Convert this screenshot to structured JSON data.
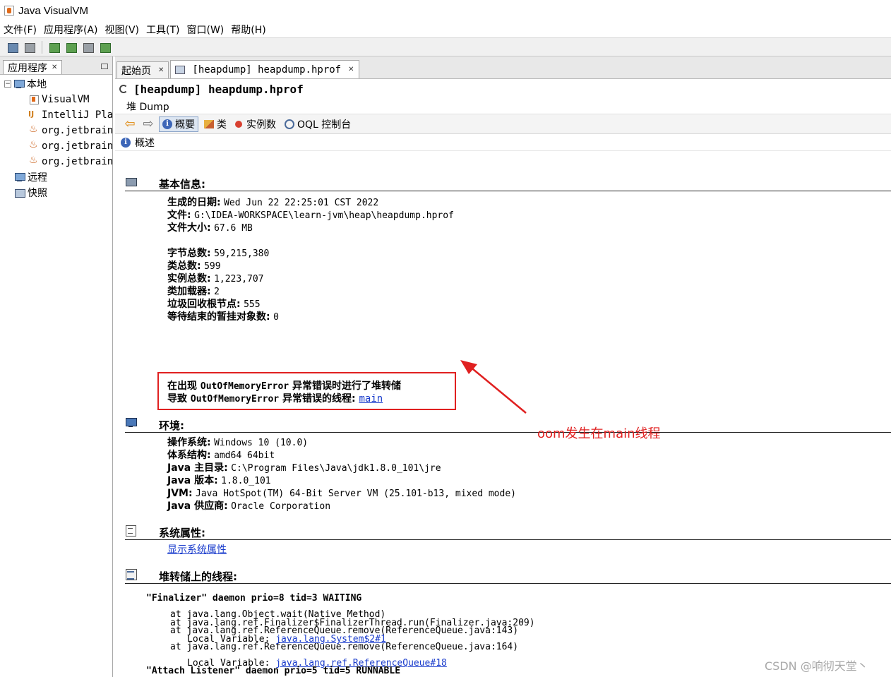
{
  "window": {
    "title": "Java VisualVM"
  },
  "menu": [
    "文件(F)",
    "应用程序(A)",
    "视图(V)",
    "工具(T)",
    "窗口(W)",
    "帮助(H)"
  ],
  "left_panel": {
    "tab_label": "应用程序",
    "tree": {
      "local": "本地",
      "items": [
        "VisualVM",
        "IntelliJ Pla",
        "org.jetbrain",
        "org.jetbrain",
        "org.jetbrain"
      ],
      "remote": "远程",
      "snapshots": "快照"
    }
  },
  "doc_tabs": [
    {
      "label": "起始页"
    },
    {
      "label": "[heapdump] heapdump.hprof"
    }
  ],
  "doc": {
    "title": "[heapdump] heapdump.hprof",
    "subtab": "堆 Dump",
    "views": {
      "summary": "概要",
      "classes": "类",
      "instances": "实例数",
      "oql": "OQL 控制台"
    },
    "overview_label": "概述"
  },
  "basic_info": {
    "title": "基本信息:",
    "generated_label": "生成的日期:",
    "generated_value": "Wed Jun 22 22:25:01 CST 2022",
    "file_label": "文件:",
    "file_value": "G:\\IDEA-WORKSPACE\\learn-jvm\\heap\\heapdump.hprof",
    "size_label": "文件大小:",
    "size_value": "67.6 MB",
    "bytes_label": "字节总数:",
    "bytes_value": "59,215,380",
    "classes_label": "类总数:",
    "classes_value": "599",
    "instances_label": "实例总数:",
    "instances_value": "1,223,707",
    "loaders_label": "类加载器:",
    "loaders_value": "2",
    "gc_roots_label": "垃圾回收根节点:",
    "gc_roots_value": "555",
    "finalizer_label": "等待结束的暂挂对象数:",
    "finalizer_value": "0",
    "oom_line1_pre": "在出现",
    "oom_line1_err": "OutOfMemoryError",
    "oom_line1_post": "异常错误时进行了堆转储",
    "oom_line2_pre": "导致",
    "oom_line2_err": "OutOfMemoryError",
    "oom_line2_post": "异常错误的线程:",
    "oom_thread_link": "main"
  },
  "environment": {
    "title": "环境:",
    "os_label": "操作系统:",
    "os_value": "Windows 10 (10.0)",
    "arch_label": "体系结构:",
    "arch_value": "amd64 64bit",
    "home_label": "Java 主目录:",
    "home_value": "C:\\Program Files\\Java\\jdk1.8.0_101\\jre",
    "version_label": "Java 版本:",
    "version_value": "1.8.0_101",
    "jvm_label": "JVM:",
    "jvm_value": "Java HotSpot(TM) 64-Bit Server VM (25.101-b13, mixed mode)",
    "vendor_label": "Java 供应商:",
    "vendor_value": "Oracle Corporation"
  },
  "system_props": {
    "title": "系统属性:",
    "link": "显示系统属性"
  },
  "threads": {
    "title": "堆转储上的线程:",
    "finalizer_header": "\"Finalizer\" daemon prio=8 tid=3 WAITING",
    "lines": [
      "at java.lang.Object.wait(Native Method)",
      "at java.lang.ref.ReferenceQueue.remove(ReferenceQueue.java:143)",
      "at java.lang.ref.ReferenceQueue.remove(ReferenceQueue.java:164)"
    ],
    "local_label": "Local Variable:",
    "local1_link": "java.lang.ref.ReferenceQueue#18",
    "line4": "at java.lang.ref.Finalizer$FinalizerThread.run(Finalizer.java:209)",
    "local2_link": "java.lang.System$2#1",
    "attach_header": "\"Attach Listener\" daemon prio=5 tid=5 RUNNABLE"
  },
  "annotation": {
    "text": "oom发生在main线程",
    "color": "#e02020"
  },
  "watermark": "CSDN @响彻天堂丶"
}
